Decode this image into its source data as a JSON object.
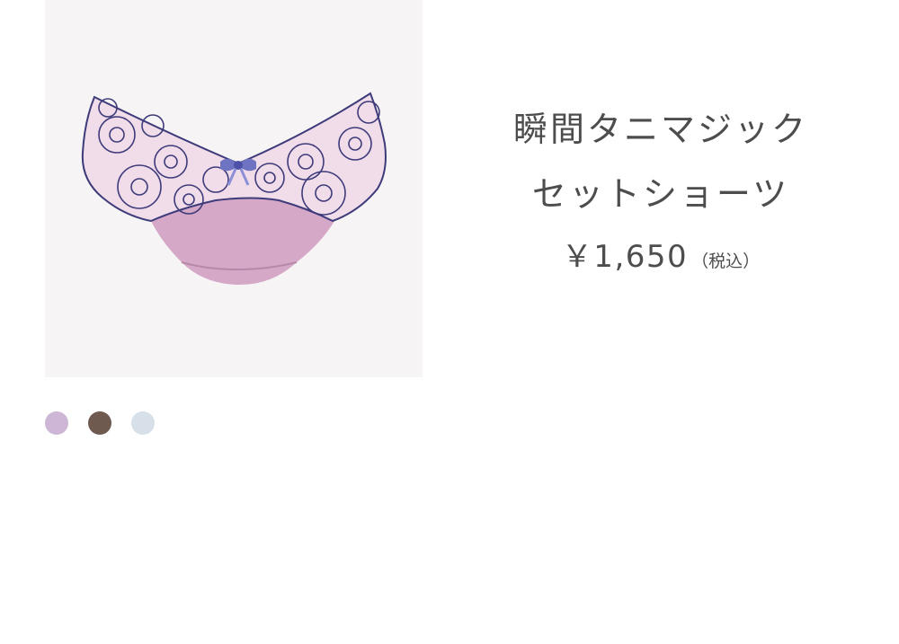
{
  "product": {
    "title_line1": "瞬間タニマジック",
    "title_line2": "セットショーツ",
    "price": "￥1,650",
    "tax_note": "（税込）"
  },
  "swatches": [
    {
      "color": "#cdb6d6"
    },
    {
      "color": "#6f5a50"
    },
    {
      "color": "#d7dfe8"
    }
  ],
  "colors": {
    "image_background": "#f7f4f5",
    "fabric_pink": "#d6a8c8",
    "lace_pink": "#f1dce9",
    "embroidery_navy": "#3d3b7a",
    "bow_blue": "#6f74c2"
  }
}
